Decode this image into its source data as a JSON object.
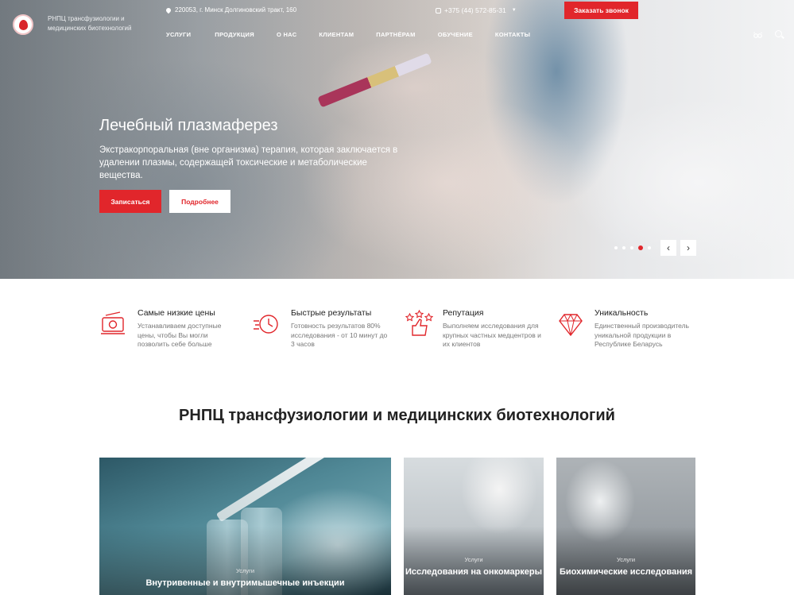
{
  "header": {
    "org_name": "РНПЦ трансфузиологии и медицинских биотехнологий",
    "address": "220053, г. Минск Долгиновский тракт, 160",
    "phone": "+375 (44) 572-85-31",
    "callback_label": "Заказать звонок",
    "nav": [
      "УСЛУГИ",
      "ПРОДУКЦИЯ",
      "О НАС",
      "КЛИЕНТАМ",
      "ПАРТНЁРАМ",
      "ОБУЧЕНИЕ",
      "КОНТАКТЫ"
    ]
  },
  "hero": {
    "title": "Лечебный плазмаферез",
    "description": "Экстракорпоральная (вне организма) терапия, которая заключается в удалении плазмы, содержащей токсические и метаболические вещества.",
    "primary_label": "Записаться",
    "secondary_label": "Подробнее",
    "slides_count": 5,
    "active_slide": 4
  },
  "features": [
    {
      "icon": "money-icon",
      "title": "Самые низкие цены",
      "text": "Устанавливаем доступные цены, чтобы Вы могли позволить себе больше"
    },
    {
      "icon": "clock-icon",
      "title": "Быстрые результаты",
      "text": "Готовность результатов 80% исследования - от 10 минут до 3 часов"
    },
    {
      "icon": "thumbs-up-stars-icon",
      "title": "Репутация",
      "text": "Выполняем исследования для крупных частных медцентров и их клиентов"
    },
    {
      "icon": "diamond-icon",
      "title": "Уникальность",
      "text": "Единственный производитель уникальной продукции в Республике Беларусь"
    }
  ],
  "section_title": "РНПЦ трансфузиологии и медицинских биотехнологий",
  "cards": [
    {
      "category": "Услуги",
      "title": "Внутривенные и внутримышечные инъекции"
    },
    {
      "category": "Услуги",
      "title": "Исследования на онкомаркеры"
    },
    {
      "category": "Услуги",
      "title": "Биохимические исследования"
    }
  ],
  "colors": {
    "accent": "#e1262b",
    "text": "#222222",
    "muted": "#777777"
  }
}
